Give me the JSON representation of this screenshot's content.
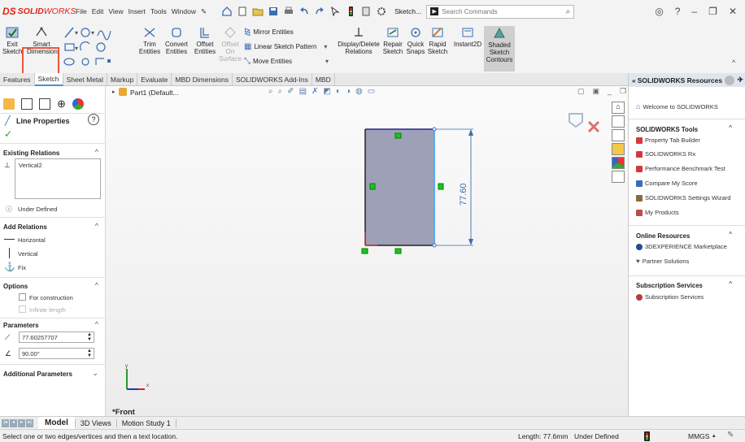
{
  "app": {
    "logo_ds": "DS",
    "logo_brand": "SOLID",
    "logo_brand2": "WORKS"
  },
  "menu": [
    "File",
    "Edit",
    "View",
    "Insert",
    "Tools",
    "Window"
  ],
  "sketch_tab": "Sketch...",
  "search": {
    "placeholder": "Search Commands"
  },
  "ribbon": {
    "exit_sketch": "Exit Sketch",
    "smart_dimension": "Smart Dimension",
    "trim_entities": "Trim Entities",
    "convert_entities": "Convert Entities",
    "offset_entities": "Offset Entities",
    "offset_on_surface": "Offset On Surface",
    "mirror_entities": "Mirror Entities",
    "linear_sketch_pattern": "Linear Sketch Pattern",
    "move_entities": "Move Entities",
    "display_delete_relations": "Display/Delete Relations",
    "repair_sketch": "Repair Sketch",
    "quick_snaps": "Quick Snaps",
    "rapid_sketch": "Rapid Sketch",
    "instant2d": "Instant2D",
    "shaded_sketch_contours": "Shaded Sketch Contours"
  },
  "tabs": [
    "Features",
    "Sketch",
    "Sheet Metal",
    "Markup",
    "Evaluate",
    "MBD Dimensions",
    "SOLIDWORKS Add-Ins",
    "MBD"
  ],
  "active_tab": "Sketch",
  "tree": {
    "part": "Part1 (Default..."
  },
  "property": {
    "title": "Line Properties",
    "existing_relations": "Existing Relations",
    "relation_item": "Vertical2",
    "status": "Under Defined",
    "add_relations": "Add Relations",
    "relations": [
      "Horizontal",
      "Vertical",
      "Fix"
    ],
    "options": "Options",
    "for_construction": "For construction",
    "infinite_length": "Infinite length",
    "parameters": "Parameters",
    "length_value": "77.60257707",
    "angle_value": "90.00°",
    "additional_parameters": "Additional Parameters"
  },
  "graphics": {
    "dimension": "77.60",
    "view_label": "*Front"
  },
  "resources": {
    "header": "SOLIDWORKS Resources",
    "welcome": "Welcome to SOLIDWORKS",
    "tools_title": "SOLIDWORKS Tools",
    "tools": [
      "Property Tab Builder",
      "SOLIDWORKS Rx",
      "Performance Benchmark Test",
      "Compare My Score",
      "SOLIDWORKS Settings Wizard",
      "My Products"
    ],
    "online_title": "Online Resources",
    "online": [
      "3DEXPERIENCE Marketplace",
      "Partner Solutions"
    ],
    "subscription_title": "Subscription Services",
    "subscription": [
      "Subscription Services"
    ]
  },
  "bottom_tabs": [
    "Model",
    "3D Views",
    "Motion Study 1"
  ],
  "status": {
    "hint": "Select one or two edges/vertices and then a text location.",
    "length": "Length: 77.6mm",
    "defined": "Under Defined",
    "units": "MMGS"
  },
  "colors": {
    "accent": "#4a8fd6",
    "highlight": "#e8573b",
    "sketch_fill": "#9ea0b8",
    "brand": "#e2231a"
  }
}
